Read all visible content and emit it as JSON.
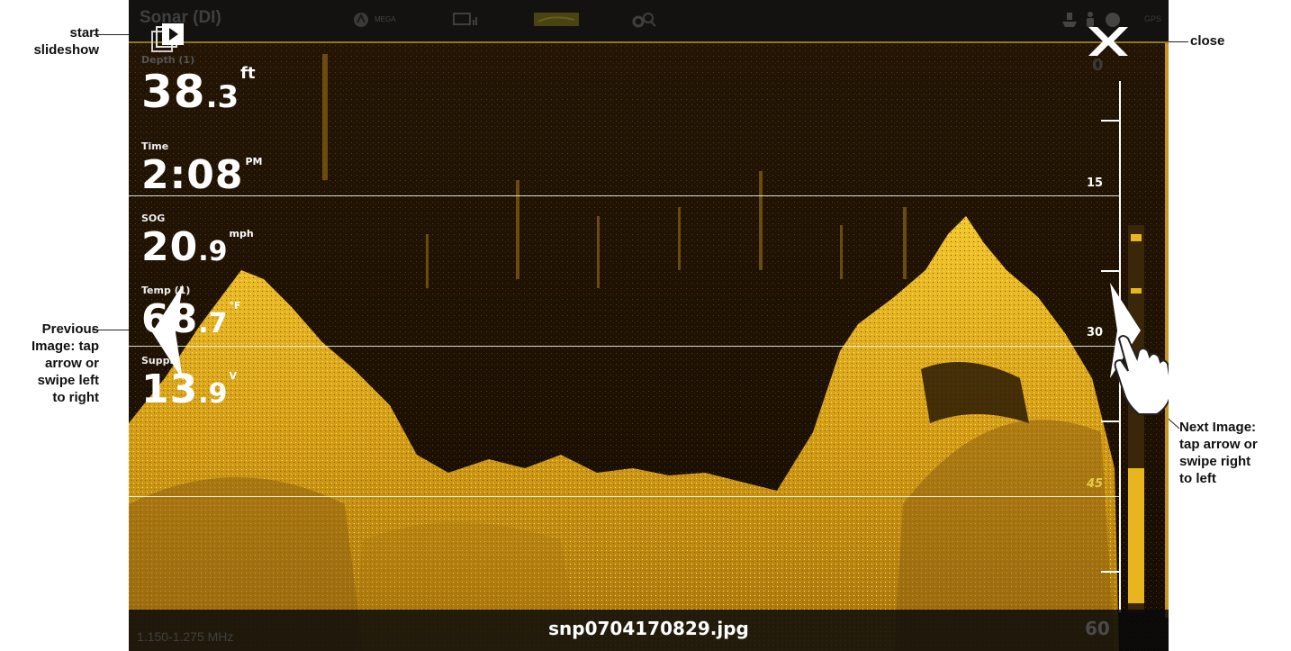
{
  "callouts": {
    "start_slideshow_1": "start",
    "start_slideshow_2": "slideshow",
    "close": "close",
    "previous_1": "Previous",
    "previous_2": "Image: tap",
    "previous_3": "arrow or",
    "previous_4": "swipe left",
    "previous_5": "to right",
    "next_1": "Next Image:",
    "next_2": "tap arrow or",
    "next_3": "swipe right",
    "next_4": "to left"
  },
  "status_bar": {
    "title": "Sonar (DI)",
    "mega_label": "MEGA",
    "gps_label": "GPS",
    "icons": [
      "mega-imaging-icon",
      "display-icon",
      "chart-thumbnail-icon",
      "settings-search-icon",
      "boat-icon",
      "person-icon",
      "gps-icon"
    ]
  },
  "readouts": {
    "depth": {
      "label": "Depth (1)",
      "value": "38",
      "decimal": ".3",
      "unit": "ft"
    },
    "time": {
      "label": "Time",
      "value": "2:08",
      "unit": "PM"
    },
    "sog": {
      "label": "SOG",
      "value": "20",
      "decimal": ".9",
      "unit": "mph"
    },
    "temp": {
      "label": "Temp (1)",
      "value": "68",
      "decimal": ".7",
      "unit": "°F"
    },
    "supply": {
      "label": "Supply",
      "value": "13",
      "decimal": ".9",
      "unit": "V"
    }
  },
  "depth_scale": {
    "top": "0",
    "marks": [
      "15",
      "30",
      "45"
    ],
    "bottom": "60"
  },
  "bottom_bar": {
    "frequency": "1.150-1.275 MHz",
    "filename": "snp0704170829.jpg"
  },
  "colors": {
    "sonar_gold": "#e8b51f",
    "sonar_dark": "#1a0e03",
    "accent_line": "#8f7a18"
  }
}
